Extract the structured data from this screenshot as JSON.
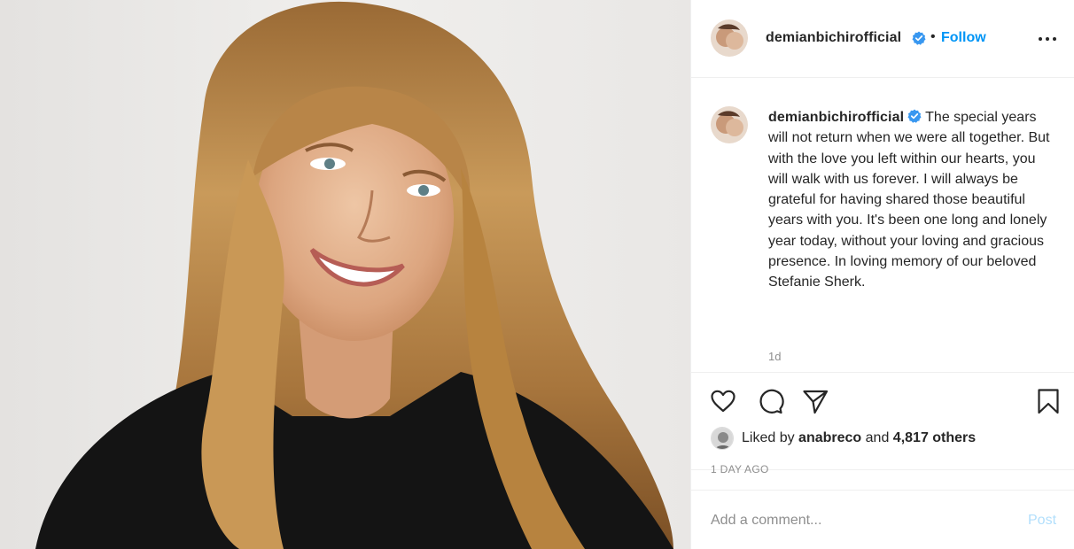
{
  "photo": {
    "description_icon": "portrait-photo"
  },
  "header": {
    "username": "demianbichirofficial",
    "separator": "•",
    "follow_label": "Follow",
    "more_icon": "more-options-icon"
  },
  "caption": {
    "username": "demianbichirofficial",
    "text": "The special years will not return when we were all together. But with the love you left within our hearts, you will walk with us forever. I will always be grateful for having shared those beautiful years with you. It's been one long and lonely year today, without your loving and gracious presence. In loving memory of our beloved Stefanie Sherk.",
    "age": "1d"
  },
  "actions": {
    "icons": [
      "heart-icon",
      "comment-icon",
      "share-icon",
      "bookmark-icon"
    ]
  },
  "likes": {
    "prefix": "Liked by",
    "user": "anabreco",
    "middle": "and",
    "others": "4,817 others"
  },
  "timestamp": "1 DAY AGO",
  "comment": {
    "placeholder": "Add a comment...",
    "post_label": "Post"
  },
  "colors": {
    "link_blue": "#0095f6",
    "post_disabled": "#b2dffc",
    "muted": "#8e8e8e",
    "verified_blue": "#3897f0"
  }
}
